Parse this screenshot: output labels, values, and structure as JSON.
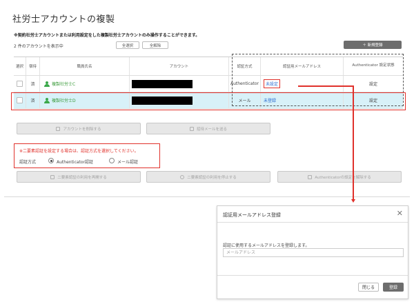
{
  "page": {
    "title": "社労士アカウントの複製",
    "note": "※契約社労士アカウントまたは利用設定をした複製社労士アカウントのみ操作することができます。",
    "count_text": "2 件のアカウントを表示中",
    "select_all": "全選択",
    "deselect_all": "全解除",
    "new_register": "＋ 新規登録"
  },
  "table": {
    "headers": [
      "選択",
      "宿待",
      "職員氏名",
      "アカウント",
      "認証方式",
      "認証用メールアドレス",
      "Authenticator 設定状態"
    ],
    "rows": [
      {
        "status": "済",
        "name": "複製社労士C",
        "auth_method": "Authenticator",
        "email": "未設定",
        "setting": "設定"
      },
      {
        "status": "済",
        "name": "複製社労士D",
        "auth_method": "メール",
        "email": "未登録",
        "setting": "設定"
      }
    ]
  },
  "actions": {
    "delete_account": "アカウントを削除する",
    "send_invite": "招待メールを送る",
    "resume_2fa": "二要素認証の利用を再開する",
    "stop_2fa": "二要素認証の利用を停止する",
    "unset_auth": "Authenticatorの設定を解除する"
  },
  "auth": {
    "note": "※二要素認証を設定する場合は、認証方式を選択してください。",
    "label": "認証方式",
    "option_authenticator": "Authenticator認証",
    "option_mail": "メール認証",
    "selected": "Authenticator認証"
  },
  "modal": {
    "title": "認証用メールアドレス登録",
    "description": "認証に使用するメールアドレスを登録します。",
    "placeholder": "メールアドレス",
    "close_label": "閉じる",
    "register_label": "登録"
  },
  "colors": {
    "highlight_red": "#e0302a",
    "selected_row": "#d8f1f8",
    "link_blue": "#2a6bd0",
    "user_green": "#3a9b3a",
    "primary_button": "#6d6d6d"
  },
  "icons": {
    "user": "user-icon",
    "trash": "trash-icon",
    "mail": "mail-icon",
    "close": "close-icon"
  }
}
